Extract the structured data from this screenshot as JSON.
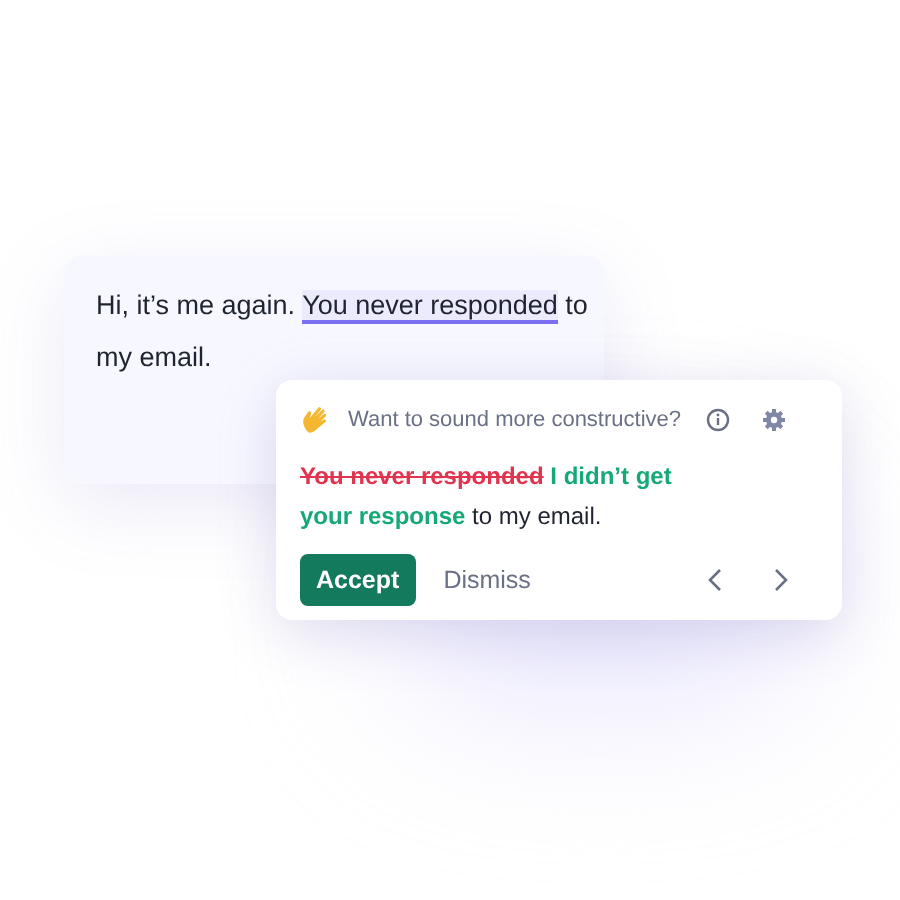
{
  "editor": {
    "text_before": "Hi, it’s me again. ",
    "highlighted": "You never responded",
    "text_after": " to my email."
  },
  "suggestion": {
    "prompt": "Want to sound more constructive?",
    "deleted": "You never responded",
    "inserted": "I didn’t get your response",
    "rest": " to my email.",
    "buttons": [
      {
        "kind": "primary",
        "label": "Accept"
      },
      {
        "kind": "secondary",
        "label": "Dismiss"
      }
    ]
  }
}
